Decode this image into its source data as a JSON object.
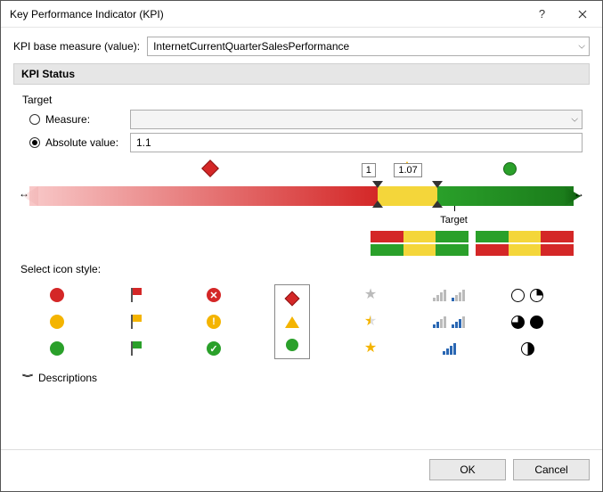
{
  "window": {
    "title": "Key Performance Indicator (KPI)"
  },
  "base_measure": {
    "label": "KPI base measure (value):",
    "value": "InternetCurrentQuarterSalesPerformance"
  },
  "status": {
    "header": "KPI Status",
    "target_label": "Target",
    "measure_option": "Measure:",
    "measure_value": "",
    "absolute_option": "Absolute value:",
    "absolute_value": "1.1",
    "slider": {
      "handle1_value": "1",
      "handle2_value": "1.07",
      "target_caption": "Target"
    }
  },
  "icon_style_label": "Select icon style:",
  "descriptions_label": "Descriptions",
  "buttons": {
    "ok": "OK",
    "cancel": "Cancel"
  },
  "chart_data": {
    "type": "other",
    "description": "KPI status threshold slider mapping value ranges to status colors",
    "absolute_target": 1.1,
    "thresholds": [
      {
        "position_pct": 64,
        "value": 1,
        "status_below": "red"
      },
      {
        "position_pct": 75,
        "value": 1.07,
        "status_below": "yellow",
        "status_above": "green"
      }
    ],
    "bands": [
      {
        "color": "red",
        "from_pct": 0,
        "to_pct": 64
      },
      {
        "color": "yellow",
        "from_pct": 64,
        "to_pct": 75
      },
      {
        "color": "green",
        "from_pct": 75,
        "to_pct": 100
      }
    ],
    "target_marker_pct": 78
  }
}
